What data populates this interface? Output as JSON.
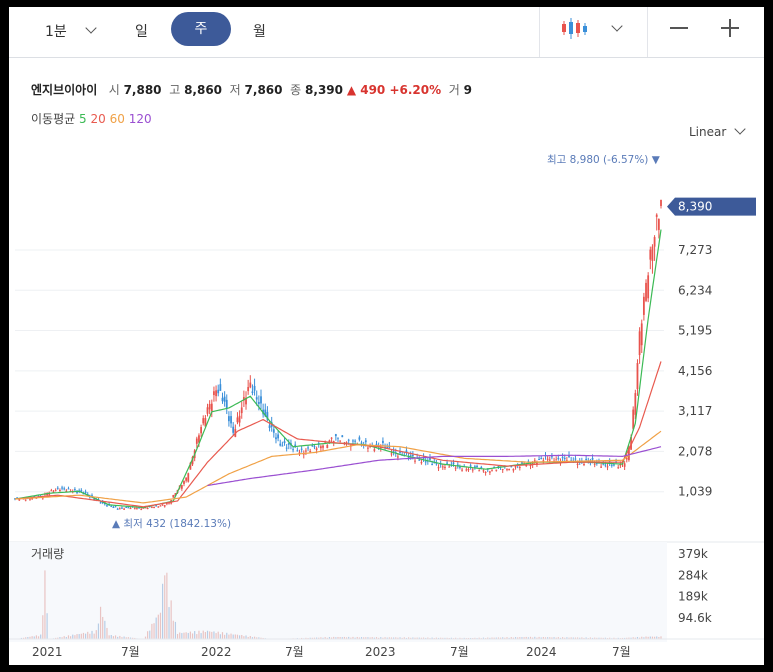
{
  "toolbar": {
    "interval_minute": "1분",
    "tabs": [
      "일",
      "주",
      "월"
    ],
    "active_tab": "주",
    "zoom_out": "—",
    "zoom_in": "+"
  },
  "stock": {
    "name": "엔지브이아이",
    "open_label": "시",
    "open": "7,880",
    "high_label": "고",
    "high": "8,860",
    "low_label": "저",
    "low": "7,860",
    "close_label": "종",
    "close": "8,390",
    "change": "▲ 490 +6.20%",
    "volume_label": "거",
    "volume": "9"
  },
  "moving_average": {
    "label": "이동평균",
    "periods": [
      "5",
      "20",
      "60",
      "120"
    ],
    "colors": [
      "#3cba55",
      "#e85a4f",
      "#f0a146",
      "#9a4fd1"
    ]
  },
  "scale_mode": "Linear",
  "chart_data": {
    "type": "candlestick",
    "price_axis": {
      "ticks": [
        1039,
        2078,
        3117,
        4156,
        5195,
        6234,
        7273
      ],
      "tick_labels": [
        "1,039",
        "2,078",
        "3,117",
        "4,156",
        "5,195",
        "6,234",
        "7,273"
      ],
      "range": [
        0,
        9800
      ]
    },
    "last_price_label": "8,390",
    "last_price": 8390,
    "max_annotation": "최고 8,980 (-6.57%)",
    "max_price": 8980,
    "min_annotation": "최저 432 (1842.13%)",
    "min_price": 432,
    "time_axis": [
      "2021",
      "7월",
      "2022",
      "7월",
      "2023",
      "7월",
      "2024",
      "7월"
    ],
    "volume_label": "거래량",
    "volume_axis": {
      "ticks": [
        379000,
        284000,
        189000,
        94600
      ],
      "tick_labels": [
        "379k",
        "284k",
        "189k",
        "94.6k"
      ]
    },
    "colors": {
      "up": "#e8534d",
      "down": "#3a8fd9",
      "last_price_bg": "#3d5a99"
    },
    "price_path": [
      [
        0,
        850
      ],
      [
        12,
        900
      ],
      [
        16,
        1050
      ],
      [
        20,
        1100
      ],
      [
        28,
        1080
      ],
      [
        36,
        900
      ],
      [
        42,
        700
      ],
      [
        48,
        620
      ],
      [
        58,
        620
      ],
      [
        66,
        650
      ],
      [
        72,
        760
      ],
      [
        80,
        1400
      ],
      [
        86,
        2500
      ],
      [
        90,
        3200
      ],
      [
        94,
        3700
      ],
      [
        98,
        3300
      ],
      [
        102,
        2600
      ],
      [
        106,
        3200
      ],
      [
        110,
        3800
      ],
      [
        114,
        3400
      ],
      [
        118,
        2800
      ],
      [
        124,
        2300
      ],
      [
        132,
        2100
      ],
      [
        140,
        2150
      ],
      [
        148,
        2400
      ],
      [
        156,
        2350
      ],
      [
        164,
        2250
      ],
      [
        172,
        2200
      ],
      [
        180,
        2000
      ],
      [
        188,
        1900
      ],
      [
        196,
        1750
      ],
      [
        204,
        1700
      ],
      [
        212,
        1650
      ],
      [
        220,
        1600
      ],
      [
        228,
        1650
      ],
      [
        236,
        1700
      ],
      [
        244,
        1850
      ],
      [
        252,
        1900
      ],
      [
        260,
        1850
      ],
      [
        268,
        1800
      ],
      [
        276,
        1750
      ],
      [
        282,
        1700
      ],
      [
        286,
        1900
      ],
      [
        288,
        2500
      ],
      [
        290,
        3600
      ],
      [
        292,
        5000
      ],
      [
        294,
        6000
      ],
      [
        296,
        6900
      ],
      [
        298,
        7500
      ],
      [
        300,
        7900
      ],
      [
        302,
        8390
      ]
    ],
    "ma_paths": {
      "5": [
        [
          0,
          850
        ],
        [
          16,
          1000
        ],
        [
          30,
          1050
        ],
        [
          44,
          700
        ],
        [
          60,
          630
        ],
        [
          74,
          800
        ],
        [
          84,
          2000
        ],
        [
          92,
          3100
        ],
        [
          100,
          3200
        ],
        [
          110,
          3500
        ],
        [
          120,
          2800
        ],
        [
          130,
          2200
        ],
        [
          148,
          2300
        ],
        [
          164,
          2250
        ],
        [
          180,
          2000
        ],
        [
          200,
          1750
        ],
        [
          220,
          1620
        ],
        [
          244,
          1800
        ],
        [
          268,
          1800
        ],
        [
          284,
          1750
        ],
        [
          290,
          2800
        ],
        [
          296,
          5500
        ],
        [
          302,
          7800
        ]
      ],
      "20": [
        [
          0,
          850
        ],
        [
          20,
          950
        ],
        [
          40,
          800
        ],
        [
          60,
          650
        ],
        [
          76,
          800
        ],
        [
          90,
          1800
        ],
        [
          104,
          2600
        ],
        [
          116,
          2900
        ],
        [
          132,
          2400
        ],
        [
          150,
          2300
        ],
        [
          170,
          2200
        ],
        [
          200,
          1850
        ],
        [
          230,
          1700
        ],
        [
          260,
          1800
        ],
        [
          284,
          1800
        ],
        [
          292,
          2700
        ],
        [
          302,
          4400
        ]
      ],
      "60": [
        [
          0,
          850
        ],
        [
          30,
          950
        ],
        [
          60,
          750
        ],
        [
          80,
          900
        ],
        [
          100,
          1500
        ],
        [
          120,
          1950
        ],
        [
          140,
          2050
        ],
        [
          160,
          2250
        ],
        [
          180,
          2200
        ],
        [
          210,
          1900
        ],
        [
          240,
          1800
        ],
        [
          284,
          1850
        ],
        [
          302,
          2600
        ]
      ],
      "120": [
        [
          90,
          1200
        ],
        [
          110,
          1380
        ],
        [
          140,
          1600
        ],
        [
          170,
          1850
        ],
        [
          200,
          1950
        ],
        [
          230,
          1950
        ],
        [
          260,
          1980
        ],
        [
          284,
          1950
        ],
        [
          302,
          2200
        ]
      ]
    },
    "volume_path": [
      [
        0,
        0
      ],
      [
        12,
        20000
      ],
      [
        14,
        310000
      ],
      [
        16,
        0
      ],
      [
        38,
        40000
      ],
      [
        40,
        150000
      ],
      [
        42,
        90000
      ],
      [
        44,
        20000
      ],
      [
        60,
        0
      ],
      [
        68,
        140000
      ],
      [
        70,
        380000
      ],
      [
        72,
        220000
      ],
      [
        76,
        30000
      ],
      [
        90,
        40000
      ],
      [
        120,
        0
      ],
      [
        150,
        10000
      ],
      [
        212,
        5000
      ],
      [
        240,
        10000
      ],
      [
        284,
        5000
      ],
      [
        296,
        12000
      ]
    ]
  }
}
